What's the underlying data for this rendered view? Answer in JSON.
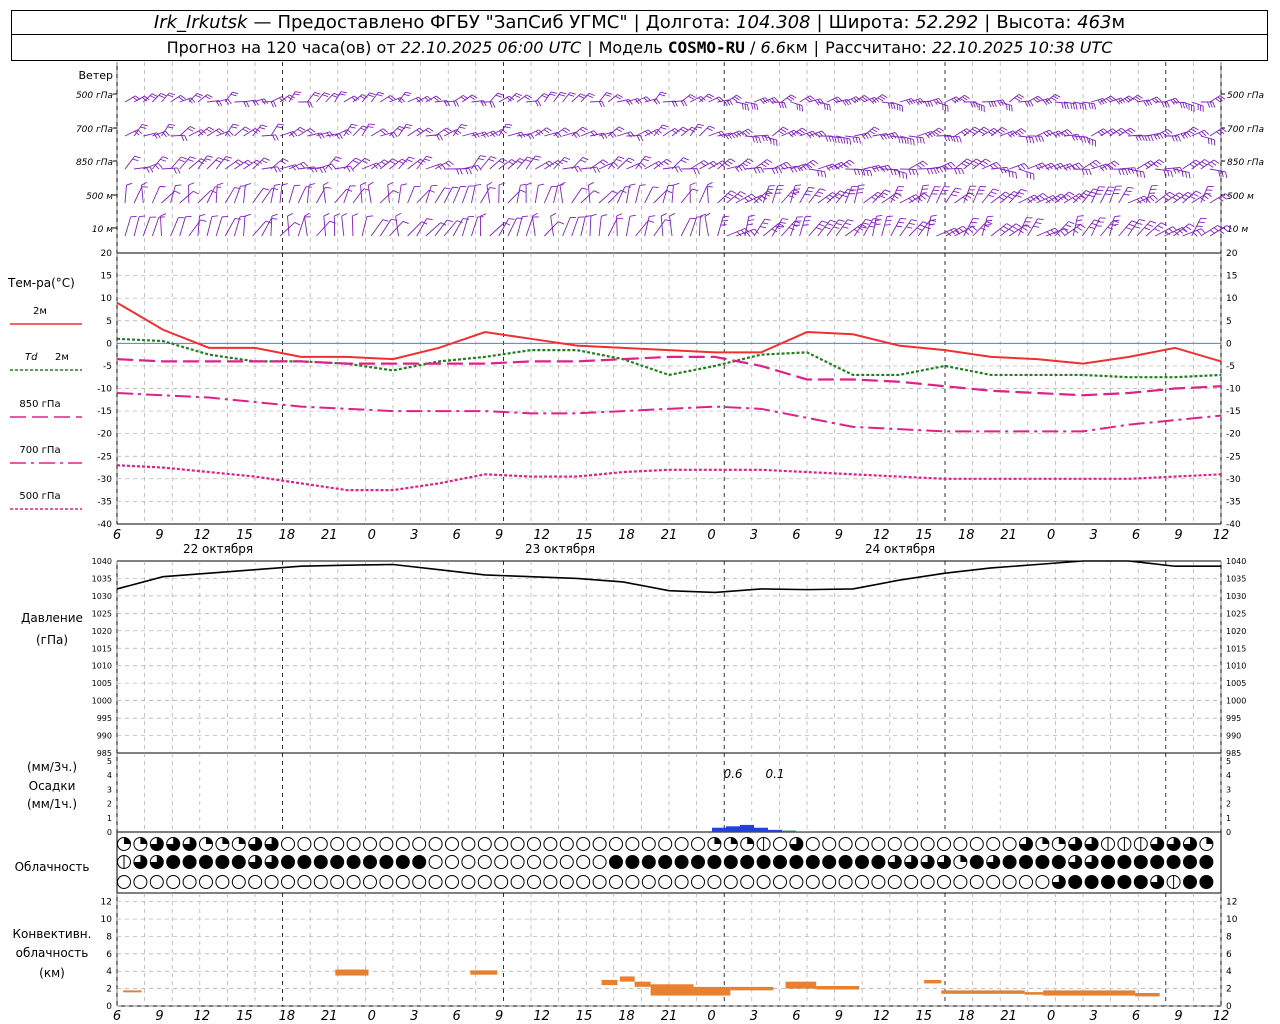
{
  "header": {
    "station": "Irk_Irkutsk",
    "dash": "—",
    "provider": "Предоставлено ФГБУ \"ЗапСиб УГМС\"",
    "lon_label": "Долгота:",
    "lon": "104.308",
    "lat_label": "Широта:",
    "lat": "52.292",
    "alt_label": "Высота:",
    "alt": "463",
    "alt_unit": "м",
    "forecast_label": "Прогноз на 120 часа(ов) от",
    "forecast_from": "22.10.2025 06:00 UTC",
    "model_label": "Модель",
    "model": "COSMO-RU",
    "model_res": "6.6",
    "model_res_unit": "км",
    "computed_label": "Рассчитано:",
    "computed": "22.10.2025 10:38 UTC"
  },
  "chart_data": [
    {
      "type": "wind_barbs",
      "title": "Ветер",
      "levels": [
        "500 гПа",
        "700 гПа",
        "850 гПа",
        "500 м",
        "10  м"
      ],
      "color": "#8020c0"
    },
    {
      "type": "line",
      "ylabel": "Тем-ра(°C)",
      "ylim": [
        -40,
        20
      ],
      "yticks": [
        20,
        15,
        10,
        5,
        0,
        -5,
        -10,
        -15,
        -20,
        -25,
        -30,
        -35,
        -40
      ],
      "x_hours": [
        6,
        9,
        12,
        15,
        18,
        21,
        24,
        27,
        30,
        33,
        36,
        39,
        42,
        45,
        48,
        51,
        54,
        57,
        60,
        63,
        66,
        69,
        72,
        75,
        78
      ],
      "series": [
        {
          "name": "2м",
          "color": "#f03030",
          "style": "solid",
          "values": [
            9,
            3,
            -1,
            -1,
            -3,
            -3,
            -3.5,
            -1,
            2.5,
            1,
            -0.5,
            -1,
            -1.5,
            -2,
            -2,
            2.5,
            2,
            -0.5,
            -1.5,
            -3,
            -3.5,
            -4.5,
            -3,
            -1,
            -4
          ]
        },
        {
          "name": "Td 2м",
          "name_prefix": "Td",
          "name_suffix": "2м",
          "color": "#208020",
          "style": "dotted",
          "values": [
            1,
            0.5,
            -2.5,
            -4,
            -4,
            -4.5,
            -6,
            -4,
            -3,
            -1.5,
            -1.5,
            -3.5,
            -7,
            -5,
            -2.5,
            -2,
            -7,
            -7,
            -5,
            -7,
            -7,
            -7,
            -7.5,
            -7.5,
            -7
          ]
        },
        {
          "name": "850 гПа",
          "color": "#e0208a",
          "style": "dash",
          "values": [
            -3.5,
            -4,
            -4,
            -4,
            -4,
            -4.5,
            -4.5,
            -4.5,
            -4.5,
            -4,
            -4,
            -3.5,
            -3,
            -3,
            -5,
            -8,
            -8,
            -8.5,
            -9.5,
            -10.5,
            -11,
            -11.5,
            -11,
            -10,
            -9.5
          ]
        },
        {
          "name": "700 гПа",
          "color": "#e0208a",
          "style": "dashdot",
          "values": [
            -11,
            -11.5,
            -12,
            -13,
            -14,
            -14.5,
            -15,
            -15,
            -15,
            -15.5,
            -15.5,
            -15,
            -14.5,
            -14,
            -14.5,
            -16.5,
            -18.5,
            -19,
            -19.5,
            -19.5,
            -19.5,
            -19.5,
            -18,
            -17,
            -16
          ]
        },
        {
          "name": "500 гПа",
          "color": "#e0208a",
          "style": "dotted",
          "values": [
            -27,
            -27.5,
            -28.5,
            -29.5,
            -31,
            -32.5,
            -32.5,
            -31,
            -29,
            -29.5,
            -29.5,
            -28.5,
            -28,
            -28,
            -28,
            -28.5,
            -29,
            -29.5,
            -30,
            -30,
            -30,
            -30,
            -30,
            -29.5,
            -29
          ]
        }
      ]
    },
    {
      "type": "line",
      "ylabel": "Давление",
      "ylabel2": "(гПа)",
      "ylim": [
        985,
        1040
      ],
      "yticks": [
        1040,
        1035,
        1030,
        1025,
        1020,
        1015,
        1010,
        1005,
        1000,
        995,
        990,
        985
      ],
      "x_hours": [
        6,
        9,
        12,
        15,
        18,
        21,
        24,
        27,
        30,
        33,
        36,
        39,
        42,
        45,
        48,
        51,
        54,
        57,
        60,
        63,
        66,
        69,
        72,
        75,
        78
      ],
      "series": [
        {
          "name": "pressure",
          "color": "#000000",
          "values": [
            1032,
            1035.5,
            1036.5,
            1037.5,
            1038.5,
            1038.8,
            1039,
            1037.5,
            1036,
            1035.5,
            1035,
            1034,
            1031.5,
            1031,
            1032,
            1031.8,
            1032,
            1034.5,
            1036.5,
            1038,
            1039,
            1040,
            1040,
            1038.5,
            1038.5
          ]
        }
      ]
    },
    {
      "type": "bar",
      "ylabel": "(мм/3ч.)",
      "ylabel2": "Осадки",
      "ylabel3": "(мм/1ч.)",
      "ylim": [
        0,
        5
      ],
      "yticks": [
        5,
        4,
        3,
        2,
        1,
        0
      ],
      "annotations": [
        "0.6",
        "0.1"
      ],
      "series": [
        {
          "name": "rain",
          "color": "#2040e0",
          "x_hours": [
            48,
            49,
            50,
            51,
            52
          ],
          "values": [
            0.3,
            0.4,
            0.5,
            0.3,
            0.15
          ]
        },
        {
          "name": "snow",
          "color": "#208060",
          "x_hours": [
            53,
            54
          ],
          "values": [
            0.1,
            0.05
          ]
        }
      ]
    },
    {
      "type": "cloud_symbols",
      "ylabel": "Облачность",
      "legend": [
        "0",
        "1",
        "2",
        "3",
        "4"
      ],
      "rows": [
        "2233322233000000000000000000000000002221030000000000000322331113332000000000000000000000000000000000000000000000000000000000",
        "1334444433444444444000000000004444444444444444433332434444334444444444444444444444444444443010000000000000000000000000000000",
        "0000000000000000000000000000000000000000000000000000000003444443144443444410044443000043000444444440000000000000000000000000"
      ]
    },
    {
      "type": "bar",
      "ylabel": "Конвективн.",
      "ylabel2": "облачность",
      "ylabel3": "(км)",
      "ylim": [
        0,
        13
      ],
      "yticks": [
        12,
        10,
        8,
        6,
        4,
        2,
        0
      ],
      "color": "#e88030",
      "segments": [
        {
          "x_start": 6.5,
          "x_end": 8,
          "bottom": 1.6,
          "top": 1.8
        },
        {
          "x_start": 23.8,
          "x_end": 26.5,
          "bottom": 3.5,
          "top": 4.2
        },
        {
          "x_start": 34.8,
          "x_end": 37,
          "bottom": 3.6,
          "top": 4.1
        },
        {
          "x_start": 45.5,
          "x_end": 46.8,
          "bottom": 2.4,
          "top": 3.0
        },
        {
          "x_start": 47,
          "x_end": 48.2,
          "bottom": 2.8,
          "top": 3.4
        },
        {
          "x_start": 48.2,
          "x_end": 49.5,
          "bottom": 2.2,
          "top": 2.8
        },
        {
          "x_start": 49.5,
          "x_end": 53,
          "bottom": 1.2,
          "top": 2.5
        },
        {
          "x_start": 53,
          "x_end": 56,
          "bottom": 1.2,
          "top": 2.2
        },
        {
          "x_start": 56,
          "x_end": 59.5,
          "bottom": 1.8,
          "top": 2.2
        },
        {
          "x_start": 60.5,
          "x_end": 63,
          "bottom": 2.0,
          "top": 2.8
        },
        {
          "x_start": 63,
          "x_end": 66.5,
          "bottom": 1.9,
          "top": 2.3
        },
        {
          "x_start": 71.8,
          "x_end": 73.2,
          "bottom": 2.6,
          "top": 3.0
        },
        {
          "x_start": 73.2,
          "x_end": 80,
          "bottom": 1.4,
          "top": 1.8
        },
        {
          "x_start": 80,
          "x_end": 81.5,
          "bottom": 1.3,
          "top": 1.6
        },
        {
          "x_start": 81.5,
          "x_end": 89,
          "bottom": 1.2,
          "top": 1.8
        },
        {
          "x_start": 89,
          "x_end": 91,
          "bottom": 1.1,
          "top": 1.5
        }
      ]
    }
  ],
  "x_axis": {
    "hour_labels": [
      "6",
      "9",
      "12",
      "15",
      "18",
      "21",
      "0",
      "3",
      "6",
      "9",
      "12",
      "15",
      "18",
      "21",
      "0",
      "3",
      "6",
      "9",
      "12",
      "15",
      "18",
      "21",
      "0",
      "3",
      "6",
      "9",
      "12"
    ],
    "date_labels": [
      "22 октября",
      "23 октября",
      "24 октября"
    ]
  }
}
